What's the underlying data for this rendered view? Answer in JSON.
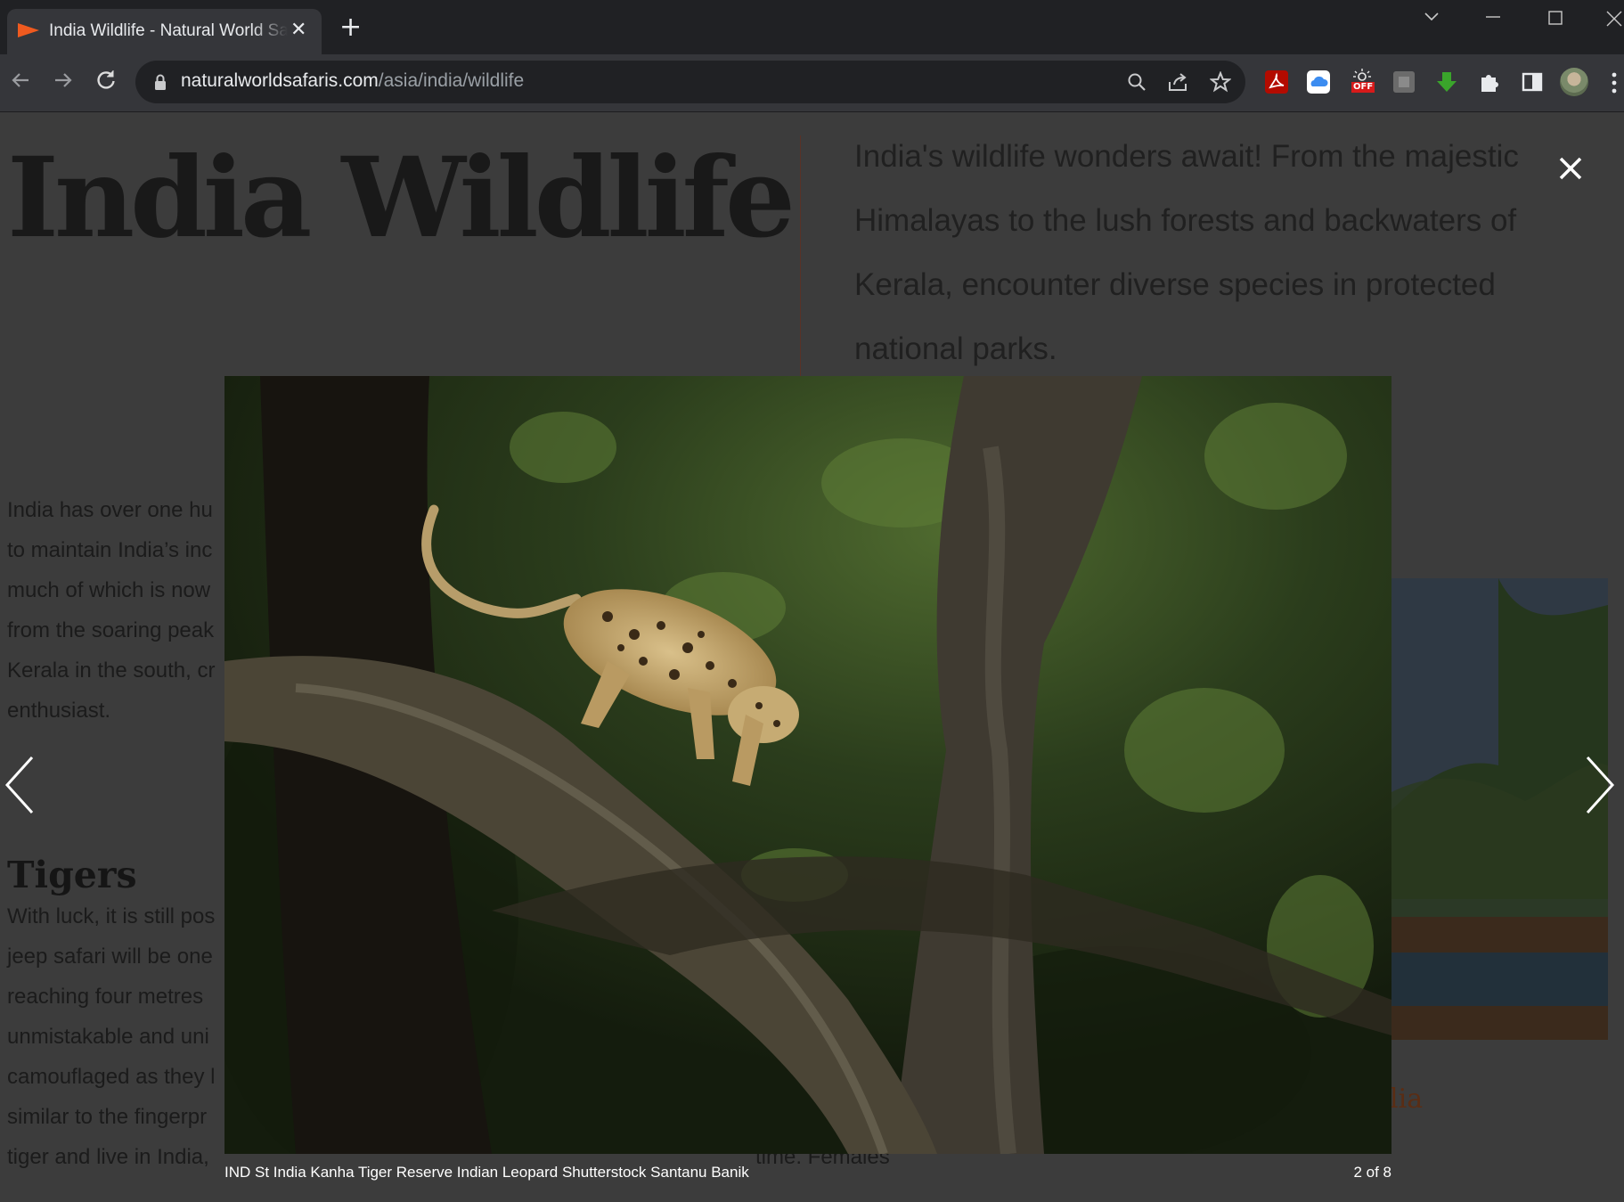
{
  "browser": {
    "tab_title": "India Wildlife - Natural World Safaris",
    "tab_close": "✕",
    "new_tab": "+",
    "url_domain": "naturalworldsafaris.com",
    "url_path": "/asia/india/wildlife",
    "pdf_ext_icon": "adobe-acrobat-icon",
    "cloud_ext_icon": "cloud-icon",
    "off_ext_label": "OFF",
    "download_ext_icon": "green-download-arrow-icon"
  },
  "page": {
    "title": "India Wildlife",
    "intro": "India's wildlife wonders await! From the majestic Himalayas to the lush forests and backwaters of Kerala, encounter diverse species in protected national parks.",
    "paragraph1": [
      "India has over one hu",
      "to maintain India’s inc",
      "much of which is now",
      "from the soaring peak",
      "Kerala in the south, cr",
      "enthusiast."
    ],
    "tigers_heading": "Tigers",
    "paragraph2": [
      "With luck, it is still pos",
      "jeep safari will be one",
      "reaching four metres",
      "unmistakable and uni",
      "camouflaged as they l",
      "similar to the fingerpr",
      "tiger and live in India,"
    ],
    "paragraph2_tail": "time. Females",
    "next_card_text": "lia"
  },
  "lightbox": {
    "image_alt": "Indian leopard walking down a tree branch in a forest",
    "caption": "IND St India Kanha Tiger Reserve Indian Leopard Shutterstock Santanu Banik",
    "counter": "2 of 8"
  }
}
